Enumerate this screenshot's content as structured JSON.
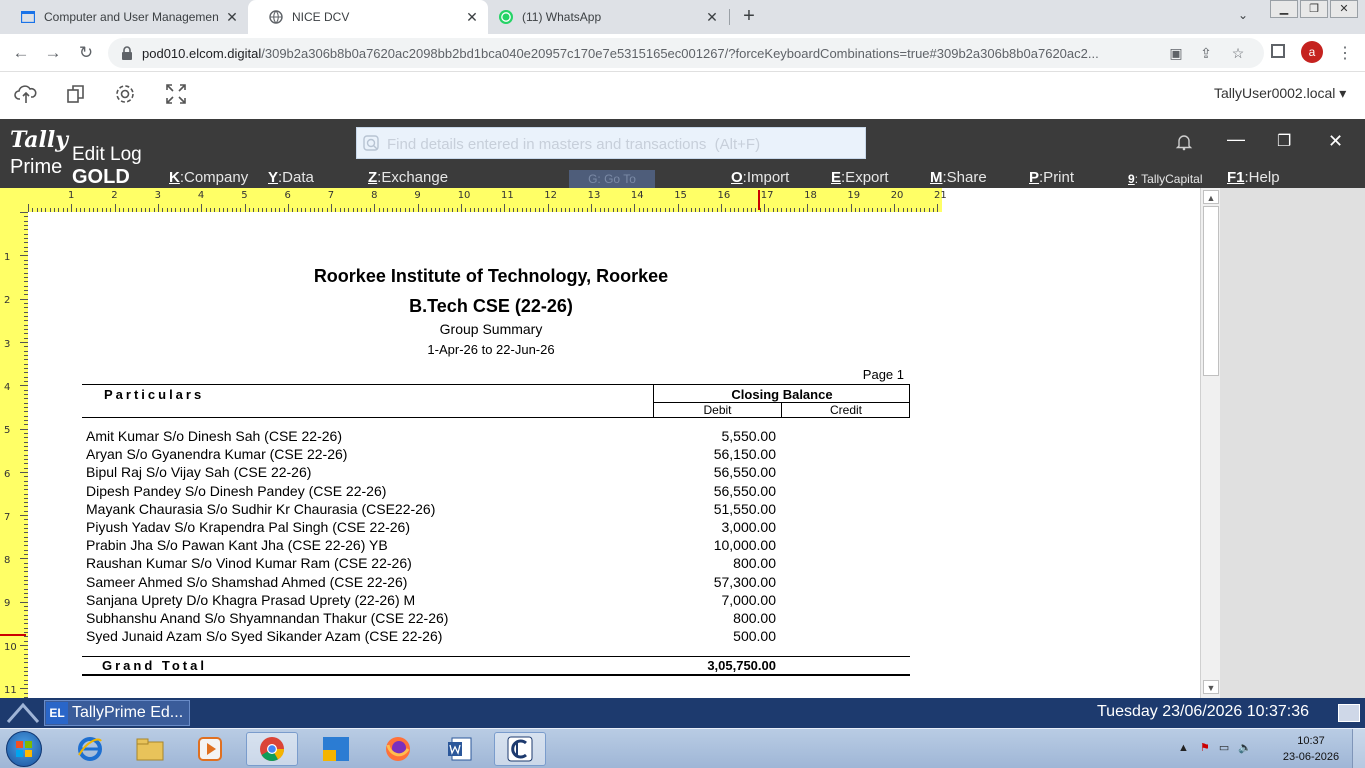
{
  "browser": {
    "tabs": [
      {
        "label": "Computer and User Managemen",
        "icon": "window-icon",
        "active": false
      },
      {
        "label": "NICE DCV",
        "icon": "globe-icon",
        "active": true
      },
      {
        "label": "(11) WhatsApp",
        "icon": "whatsapp-icon",
        "active": false
      }
    ],
    "url_host": "pod010.elcom.digital",
    "url_path": "/309b2a306b8b0a7620ac2098bb2bd1bca040e20957c170e7e5315165ec001267/?forceKeyboardCombinations=true#309b2a306b8b0a7620ac2...",
    "profile_initial": "a"
  },
  "dcv": {
    "user": "TallyUser0002.local"
  },
  "tally": {
    "logo_top": "Tally",
    "logo_bottom": "Prime",
    "edition": "GOLD",
    "window_title": "Edit Log",
    "search_placeholder": "Find details entered in masters and transactions  (Alt+F)",
    "menu": {
      "company_key": "K",
      "company": ":Company",
      "data_key": "Y",
      "data": ":Data",
      "exchange_key": "Z",
      "exchange": ":Exchange",
      "goto": "G: Go To",
      "import_key": "O",
      "import": ":Import",
      "export_key": "E",
      "export": ":Export",
      "share_key": "M",
      "share": ":Share",
      "print_key": "P",
      "print": ":Print",
      "capital_key": "9",
      "capital": ": TallyCapital",
      "help_key": "F1",
      "help": ":Help"
    },
    "ruler_h": [
      "1",
      "2",
      "3",
      "4",
      "5",
      "6",
      "7",
      "8",
      "9",
      "10",
      "11",
      "12",
      "13",
      "14",
      "15",
      "16",
      "17",
      "18",
      "19",
      "20",
      "21"
    ],
    "ruler_v": [
      "1",
      "2",
      "3",
      "4",
      "5",
      "6",
      "7",
      "8",
      "9",
      "10",
      "11"
    ]
  },
  "report": {
    "institute": "Roorkee Institute of Technology, Roorkee",
    "group": "B.Tech CSE (22-26)",
    "type": "Group Summary",
    "period": "1-Apr-26 to 22-Jun-26",
    "page": "Page 1",
    "col_particulars": "Particulars",
    "col_closing": "Closing Balance",
    "col_debit": "Debit",
    "col_credit": "Credit",
    "rows": [
      {
        "name": "Amit Kumar S/o Dinesh Sah (CSE 22-26)",
        "debit": "5,550.00"
      },
      {
        "name": "Aryan S/o Gyanendra Kumar (CSE 22-26)",
        "debit": "56,150.00"
      },
      {
        "name": "Bipul Raj S/o Vijay Sah (CSE 22-26)",
        "debit": "56,550.00"
      },
      {
        "name": "Dipesh Pandey S/o Dinesh Pandey (CSE 22-26)",
        "debit": "56,550.00"
      },
      {
        "name": "Mayank Chaurasia S/o Sudhir Kr Chaurasia (CSE22-26)",
        "debit": "51,550.00"
      },
      {
        "name": "Piyush Yadav S/o Krapendra Pal Singh (CSE 22-26)",
        "debit": "3,000.00"
      },
      {
        "name": "Prabin Jha S/o Pawan Kant Jha (CSE 22-26) YB",
        "debit": "10,000.00"
      },
      {
        "name": "Raushan Kumar S/o Vinod Kumar Ram (CSE 22-26)",
        "debit": "800.00"
      },
      {
        "name": "Sameer Ahmed S/o Shamshad Ahmed (CSE 22-26)",
        "debit": "57,300.00"
      },
      {
        "name": "Sanjana Uprety D/o Khagra Prasad Uprety (22-26) M",
        "debit": "7,000.00"
      },
      {
        "name": "Subhanshu Anand S/o Shyamnandan Thakur (CSE 22-26)",
        "debit": "800.00"
      },
      {
        "name": "Syed Junaid Azam S/o Syed Sikander Azam (CSE 22-26)",
        "debit": "500.00"
      }
    ],
    "total_label": "Grand Total",
    "total_debit": "3,05,750.00"
  },
  "statusbar": {
    "task_badge": "EL",
    "task_label": "TallyPrime Ed...",
    "datetime": "Tuesday 23/06/2026 10:37:36"
  },
  "taskbar": {
    "time": "10:37",
    "date": "23-06-2026"
  },
  "colors": {
    "tally_bar": "#3b3b3b",
    "ruler": "#ffff66",
    "status_blue": "#1d3a6e"
  }
}
